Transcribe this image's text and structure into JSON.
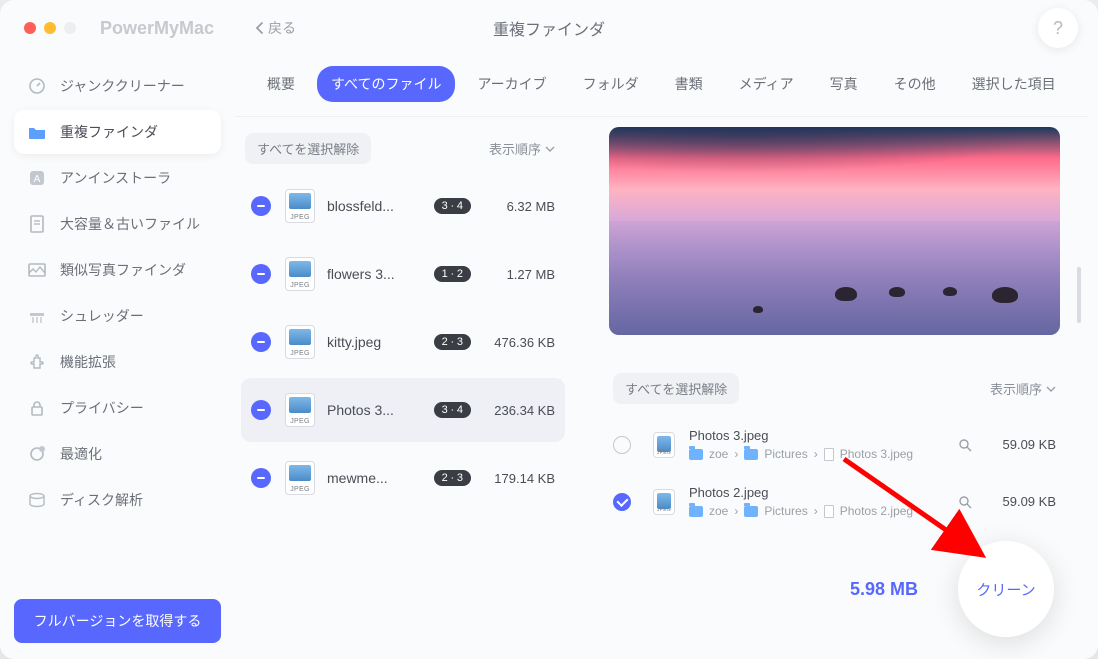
{
  "app_title": "PowerMyMac",
  "back_label": "戻る",
  "page_title": "重複ファインダ",
  "help": "?",
  "sidebar": {
    "items": [
      {
        "label": "ジャンククリーナー",
        "icon": "gauge",
        "active": false
      },
      {
        "label": "重複ファインダ",
        "icon": "folder",
        "active": true
      },
      {
        "label": "アンインストーラ",
        "icon": "app",
        "active": false
      },
      {
        "label": "大容量＆古いファイル",
        "icon": "file",
        "active": false
      },
      {
        "label": "類似写真ファインダ",
        "icon": "image",
        "active": false
      },
      {
        "label": "シュレッダー",
        "icon": "shred",
        "active": false
      },
      {
        "label": "機能拡張",
        "icon": "plugin",
        "active": false
      },
      {
        "label": "プライバシー",
        "icon": "lock",
        "active": false
      },
      {
        "label": "最適化",
        "icon": "boost",
        "active": false
      },
      {
        "label": "ディスク解析",
        "icon": "disk",
        "active": false
      }
    ],
    "full_version": "フルバージョンを取得する"
  },
  "tabs": [
    "概要",
    "すべてのファイル",
    "アーカイブ",
    "フォルダ",
    "書類",
    "メディア",
    "写真",
    "その他",
    "選択した項目"
  ],
  "active_tab": 1,
  "list": {
    "deselect_all": "すべてを選択解除",
    "sort": "表示順序",
    "rows": [
      {
        "name": "blossfeld...",
        "badge": "3 ∙ 4",
        "size": "6.32 MB",
        "selected": false
      },
      {
        "name": "flowers 3...",
        "badge": "1 ∙ 2",
        "size": "1.27 MB",
        "selected": false
      },
      {
        "name": "kitty.jpeg",
        "badge": "2 ∙ 3",
        "size": "476.36 KB",
        "selected": false
      },
      {
        "name": "Photos 3...",
        "badge": "3 ∙ 4",
        "size": "236.34 KB",
        "selected": true
      },
      {
        "name": "mewme...",
        "badge": "2 ∙ 3",
        "size": "179.14 KB",
        "selected": false
      }
    ]
  },
  "detail": {
    "deselect_all": "すべてを選択解除",
    "sort": "表示順序",
    "files": [
      {
        "name": "Photos 3.jpeg",
        "path": [
          "zoe",
          "Pictures",
          "Photos 3.jpeg"
        ],
        "size": "59.09 KB",
        "checked": false
      },
      {
        "name": "Photos 2.jpeg",
        "path": [
          "zoe",
          "Pictures",
          "Photos 2.jpeg"
        ],
        "size": "59.09 KB",
        "checked": true
      }
    ]
  },
  "total_size": "5.98 MB",
  "clean_label": "クリーン",
  "thumb_tag": "JPEG",
  "path_sep": "›"
}
